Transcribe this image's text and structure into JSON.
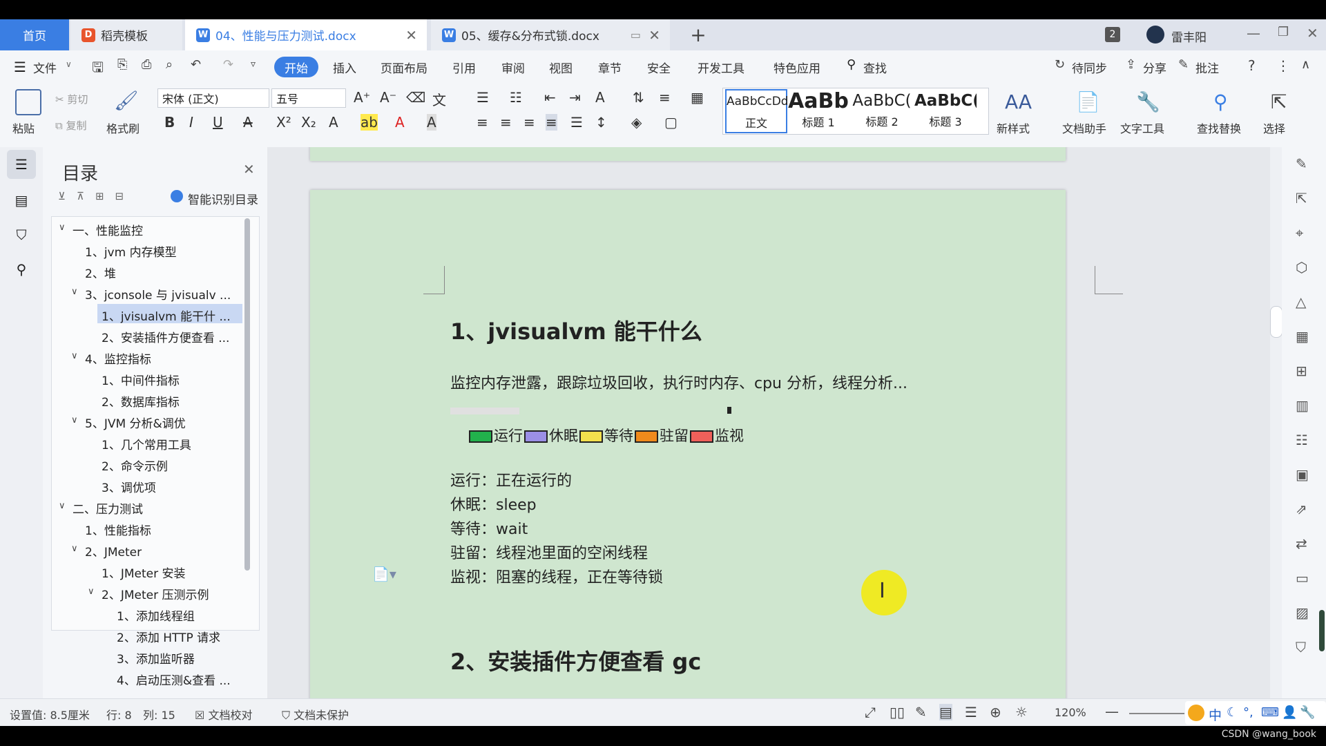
{
  "tabs": {
    "home": "首页",
    "template": "稻壳模板",
    "doc1": "04、性能与压力测试.docx",
    "doc2": "05、缓存&分布式锁.docx",
    "counter": "2",
    "user": "雷丰阳"
  },
  "menu": {
    "file": "文件",
    "items": [
      "开始",
      "插入",
      "页面布局",
      "引用",
      "审阅",
      "视图",
      "章节",
      "安全",
      "开发工具",
      "特色应用"
    ],
    "search": "查找",
    "sync": "待同步",
    "share": "分享",
    "comment": "批注"
  },
  "ribbon": {
    "paste": "粘贴",
    "cut": "剪切",
    "copy": "复制",
    "format_painter": "格式刷",
    "font_name": "宋体 (正文)",
    "font_size": "五号",
    "styles": [
      {
        "preview": "AaBbCcDd",
        "label": "正文"
      },
      {
        "preview": "AaBb",
        "label": "标题 1"
      },
      {
        "preview": "AaBbC(",
        "label": "标题 2"
      },
      {
        "preview": "AaBbC(",
        "label": "标题 3"
      }
    ],
    "new_style": "新样式",
    "doc_assistant": "文档助手",
    "text_tools": "文字工具",
    "find_replace": "查找替换",
    "select": "选择"
  },
  "toc": {
    "title": "目录",
    "smart": "智能识别目录",
    "items": [
      {
        "text": "一、性能监控",
        "level": 0,
        "chev": "v"
      },
      {
        "text": "1、jvm 内存模型",
        "level": 1
      },
      {
        "text": "2、堆",
        "level": 1
      },
      {
        "text": "3、jconsole 与 jvisualv ...",
        "level": 1,
        "chev": "v"
      },
      {
        "text": "1、jvisualvm 能干什 ...",
        "level": 2,
        "selected": true
      },
      {
        "text": "2、安装插件方便查看 ...",
        "level": 2
      },
      {
        "text": "4、监控指标",
        "level": 1,
        "chev": "v"
      },
      {
        "text": "1、中间件指标",
        "level": 2
      },
      {
        "text": "2、数据库指标",
        "level": 2
      },
      {
        "text": "5、JVM 分析&调优",
        "level": 1,
        "chev": "v"
      },
      {
        "text": "1、几个常用工具",
        "level": 2
      },
      {
        "text": "2、命令示例",
        "level": 2
      },
      {
        "text": "3、调优项",
        "level": 2
      },
      {
        "text": "二、压力测试",
        "level": 0,
        "chev": "v"
      },
      {
        "text": "1、性能指标",
        "level": 1
      },
      {
        "text": "2、JMeter",
        "level": 1,
        "chev": "v"
      },
      {
        "text": "1、JMeter 安装",
        "level": 2
      },
      {
        "text": "2、JMeter 压测示例",
        "level": 2,
        "chev": "v"
      },
      {
        "text": "1、添加线程组",
        "level": 3
      },
      {
        "text": "2、添加 HTTP 请求",
        "level": 3
      },
      {
        "text": "3、添加监听器",
        "level": 3
      },
      {
        "text": "4、启动压测&查看 ...",
        "level": 3
      }
    ]
  },
  "doc": {
    "heading1": "1、jvisualvm 能干什么",
    "para": "监控内存泄露，跟踪垃圾回收，执行时内存、cpu 分析，线程分析...",
    "legend": [
      {
        "label": "运行",
        "color": "#22b14c"
      },
      {
        "label": "休眠",
        "color": "#9b8fe6"
      },
      {
        "label": "等待",
        "color": "#f4e04d"
      },
      {
        "label": "驻留",
        "color": "#f08a1c"
      },
      {
        "label": "监视",
        "color": "#f0605a"
      }
    ],
    "lines": [
      "运行：正在运行的",
      "休眠：sleep",
      "等待：wait",
      "驻留：线程池里面的空闲线程",
      "监视：阻塞的线程，正在等待锁"
    ],
    "heading2": "2、安装插件方便查看 gc"
  },
  "status": {
    "setting": "设置值: 8.5厘米",
    "row": "行: 8",
    "col": "列: 15",
    "proof": "文档校对",
    "protect": "文档未保护",
    "zoom": "120%",
    "ime": "中"
  },
  "watermark": "CSDN @wang_book"
}
